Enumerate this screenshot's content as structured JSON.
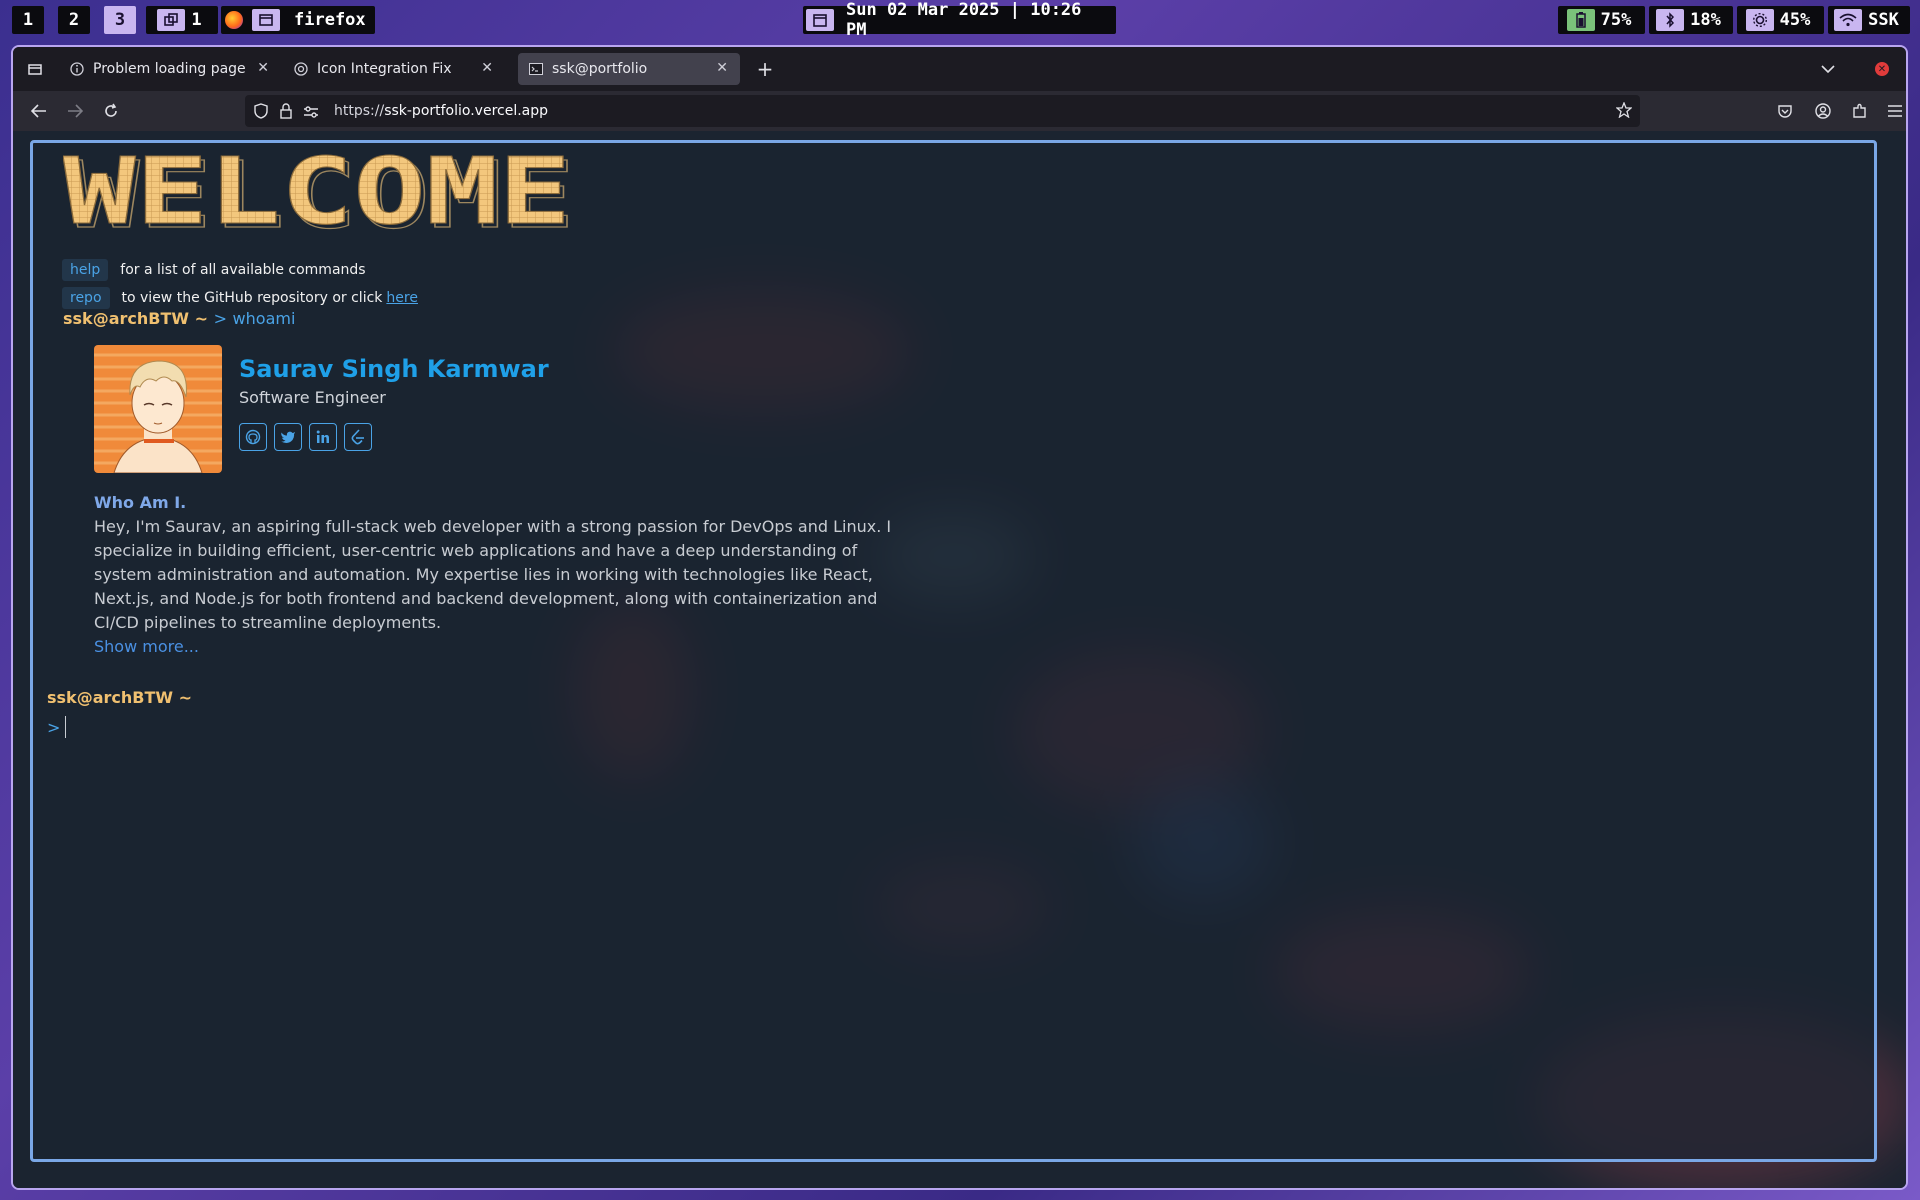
{
  "topbar": {
    "workspaces": [
      "1",
      "2",
      "3"
    ],
    "window_count": "1",
    "app_name": "firefox",
    "datetime": "Sun 02 Mar 2025 | 10:26 PM",
    "battery": "75%",
    "bluetooth": "18%",
    "brightness": "45%",
    "user": "SSK"
  },
  "browser": {
    "tabs": [
      {
        "label": "Problem loading page",
        "icon": "info-icon"
      },
      {
        "label": "Icon Integration Fix",
        "icon": "openai-icon"
      },
      {
        "label": "ssk@portfolio",
        "icon": "terminal-icon"
      }
    ],
    "url_scheme": "https://",
    "url_host": "ssk-portfolio.vercel.app"
  },
  "page": {
    "banner": "WELCOME",
    "hints": [
      {
        "cmd": "help",
        "text": "for a list of all available commands",
        "link": ""
      },
      {
        "cmd": "repo",
        "text": "to view the GitHub repository or click",
        "link": "here"
      }
    ],
    "prompt_user": "ssk@archBTW ~",
    "prompt_symbol": ">",
    "last_command": "whoami",
    "profile": {
      "name": "Saurav Singh Karmwar",
      "role": "Software Engineer",
      "socials": [
        "github-icon",
        "twitter-icon",
        "linkedin-icon",
        "leetcode-icon"
      ]
    },
    "whoami_heading": "Who Am I.",
    "bio": "Hey, I'm Saurav, an aspiring full-stack web developer with a strong passion for DevOps and Linux. I specialize in building efficient, user-centric web applications and have a deep understanding of system administration and automation. My expertise lies in working with technologies like React, Next.js, and Node.js for both frontend and backend development, along with containerization and CI/CD pipelines to streamline deployments.",
    "show_more": "Show more...",
    "input_value": ""
  },
  "colors": {
    "accent_blue": "#1fa0e8",
    "prompt_yellow": "#f0c070",
    "terminal_border": "#7aa7e6",
    "active_workspace": "#c9b6f0"
  }
}
